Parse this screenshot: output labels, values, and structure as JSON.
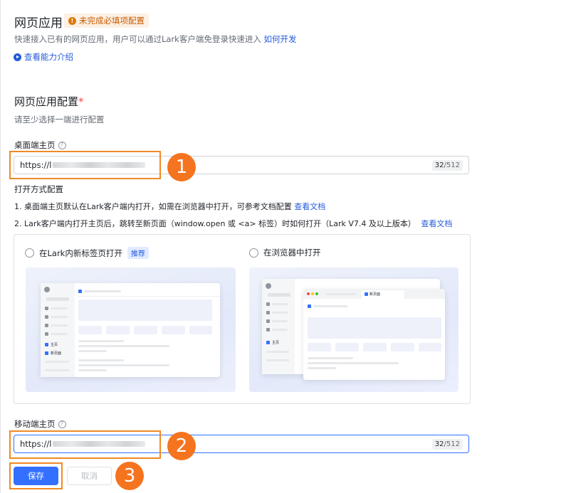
{
  "header": {
    "title": "网页应用",
    "warning_badge": "未完成必填项配置",
    "desc_text": "快速接入已有的网页应用，用户可以通过Lark客户端免登录快速进入",
    "desc_link": "如何开发",
    "intro_link": "查看能力介绍"
  },
  "config": {
    "section_title": "网页应用配置",
    "required_mark": "*",
    "hint": "请至少选择一端进行配置"
  },
  "desktop": {
    "label": "桌面端主页",
    "url_prefix": "https://l",
    "counter_used": "32",
    "counter_max": "/512"
  },
  "open_mode": {
    "title": "打开方式配置",
    "line1_text": "1. 桌面端主页默认在Lark客户端内打开，如需在浏览器中打开，可参考文档配置",
    "line1_link": "查看文档",
    "line2_text": "2. Lark客户端内打开主页后，跳转至新页面（window.open 或 <a> 标签）时如何打开（Lark V7.4 及以上版本）",
    "line2_link": "查看文档",
    "option1_label": "在Lark内新标签页打开",
    "option1_tag": "推荐",
    "option2_label": "在浏览器中打开"
  },
  "preview": {
    "home_label": "主页",
    "new_page_label": "新页面"
  },
  "mobile": {
    "label": "移动端主页",
    "url_prefix": "https://l",
    "counter_used": "32",
    "counter_max": "/512"
  },
  "actions": {
    "save_label": "保存",
    "cancel_label": "取消"
  },
  "annotations": {
    "step1": "1",
    "step2": "2",
    "step3": "3"
  },
  "colors": {
    "primary": "#3370ff",
    "link": "#245bdb",
    "warning": "#de7802",
    "annotation": "#f5741f"
  }
}
